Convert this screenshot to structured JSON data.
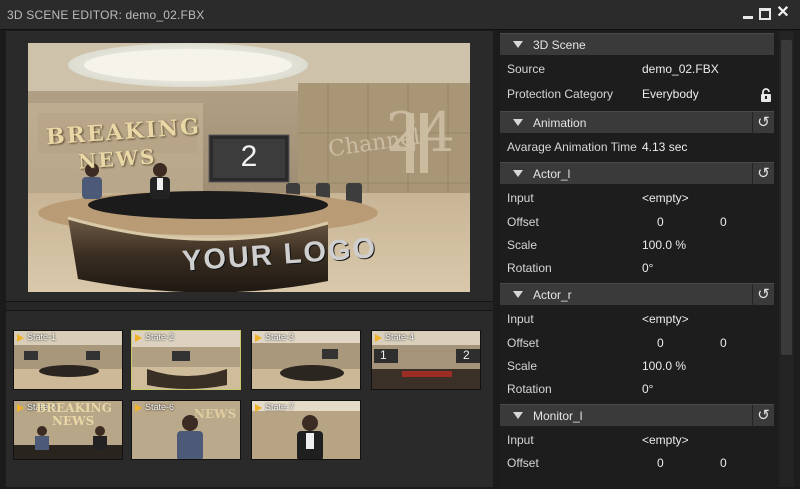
{
  "window": {
    "title": "3D SCENE EDITOR: demo_02.FBX"
  },
  "preview": {
    "headline_line1": "BREAKING",
    "headline_line2": "NEWS",
    "monitor_number": "2",
    "channel_word": "Channel",
    "channel_number": "24",
    "desk_logo": "YOUR LOGO"
  },
  "states": [
    {
      "label": "State-1",
      "selected": false
    },
    {
      "label": "State-2",
      "selected": true
    },
    {
      "label": "State-3",
      "selected": false
    },
    {
      "label": "State-4",
      "selected": false
    },
    {
      "label": "State-5",
      "selected": false
    },
    {
      "label": "State-6",
      "selected": false
    },
    {
      "label": "State-7",
      "selected": false
    }
  ],
  "thumb_text": {
    "breaking": "BREAKING",
    "news": "NEWS",
    "n1": "1",
    "n2": "2"
  },
  "properties": {
    "scene": {
      "title": "3D Scene",
      "source_label": "Source",
      "source_value": "demo_02.FBX",
      "protection_label": "Protection Category",
      "protection_value": "Everybody"
    },
    "animation": {
      "title": "Animation",
      "avg_label": "Avarage Animation Time",
      "avg_value": "4.13 sec"
    },
    "actor_l": {
      "title": "Actor_l",
      "input_label": "Input",
      "input_value": "<empty>",
      "offset_label": "Offset",
      "offset_x": "0",
      "offset_y": "0",
      "scale_label": "Scale",
      "scale_value": "100.0 %",
      "rotation_label": "Rotation",
      "rotation_value": "0°"
    },
    "actor_r": {
      "title": "Actor_r",
      "input_label": "Input",
      "input_value": "<empty>",
      "offset_label": "Offset",
      "offset_x": "0",
      "offset_y": "0",
      "scale_label": "Scale",
      "scale_value": "100.0 %",
      "rotation_label": "Rotation",
      "rotation_value": "0°"
    },
    "monitor_l": {
      "title": "Monitor_l",
      "input_label": "Input",
      "input_value": "<empty>",
      "offset_label": "Offset",
      "offset_x": "0",
      "offset_y": "0"
    }
  },
  "icons": {
    "minimize": "minimize-icon",
    "maximize": "maximize-icon",
    "close": "close-icon",
    "collapse": "triangle-down-icon",
    "reset": "reset-icon",
    "lock": "unlock-icon"
  },
  "colors": {
    "accent_selected": "#c7c96a",
    "play_marker": "#f0b22a",
    "headline_gold": "#e9d7a6"
  }
}
